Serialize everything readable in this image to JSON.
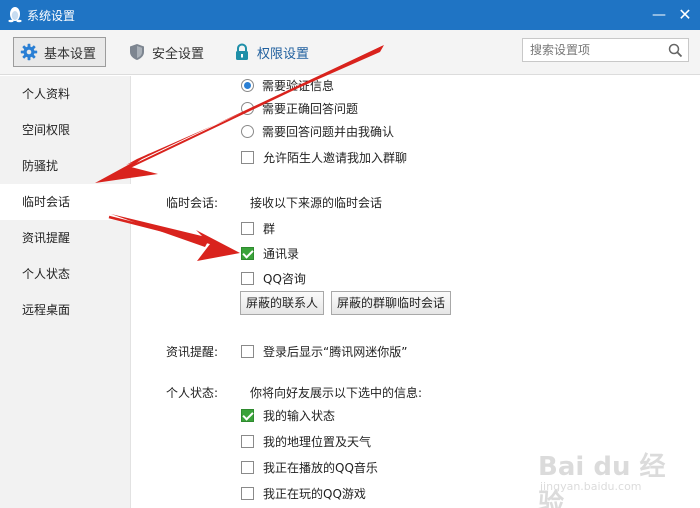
{
  "window": {
    "title": "系统设置",
    "minimize_glyph": "—",
    "close_glyph": "✕"
  },
  "toolbar": {
    "tabs": [
      {
        "label": "基本设置",
        "icon": "gear-icon"
      },
      {
        "label": "安全设置",
        "icon": "shield-icon"
      },
      {
        "label": "权限设置",
        "icon": "lock-icon"
      }
    ],
    "search": {
      "placeholder": "搜索设置项",
      "value": ""
    }
  },
  "sidebar": {
    "items": [
      {
        "label": "个人资料"
      },
      {
        "label": "空间权限"
      },
      {
        "label": "防骚扰"
      },
      {
        "label": "临时会话",
        "active": true
      },
      {
        "label": "资讯提醒"
      },
      {
        "label": "个人状态"
      },
      {
        "label": "远程桌面"
      }
    ]
  },
  "verification": {
    "options": [
      {
        "label": "需要验证信息",
        "checked": true
      },
      {
        "label": "需要正确回答问题",
        "checked": false
      },
      {
        "label": "需要回答问题并由我确认",
        "checked": false
      }
    ],
    "allow_invite": {
      "label": "允许陌生人邀请我加入群聊",
      "checked": false
    }
  },
  "temp_session": {
    "label": "临时会话:",
    "desc": "接收以下来源的临时会话",
    "options": [
      {
        "label": "群",
        "checked": false
      },
      {
        "label": "通讯录",
        "checked": true
      },
      {
        "label": "QQ咨询",
        "checked": false
      }
    ],
    "buttons": {
      "blocked_contacts": "屏蔽的联系人",
      "blocked_group_sessions": "屏蔽的群聊临时会话"
    }
  },
  "news_reminder": {
    "label": "资讯提醒:",
    "option": {
      "label": "登录后显示“腾讯网迷你版”",
      "checked": false
    }
  },
  "personal_status": {
    "label": "个人状态:",
    "desc": "你将向好友展示以下选中的信息:",
    "options": [
      {
        "label": "我的输入状态",
        "checked": true
      },
      {
        "label": "我的地理位置及天气",
        "checked": false
      },
      {
        "label": "我正在播放的QQ音乐",
        "checked": false
      },
      {
        "label": "我正在玩的QQ游戏",
        "checked": false
      }
    ]
  },
  "watermark": {
    "text": "Bai du 经验",
    "sub": "jingyan.baidu.com"
  },
  "colors": {
    "titlebar": "#1f74c4",
    "accent_check": "#3aa33a",
    "radio_dot": "#2a7fd4",
    "arrow": "#d9231d"
  }
}
